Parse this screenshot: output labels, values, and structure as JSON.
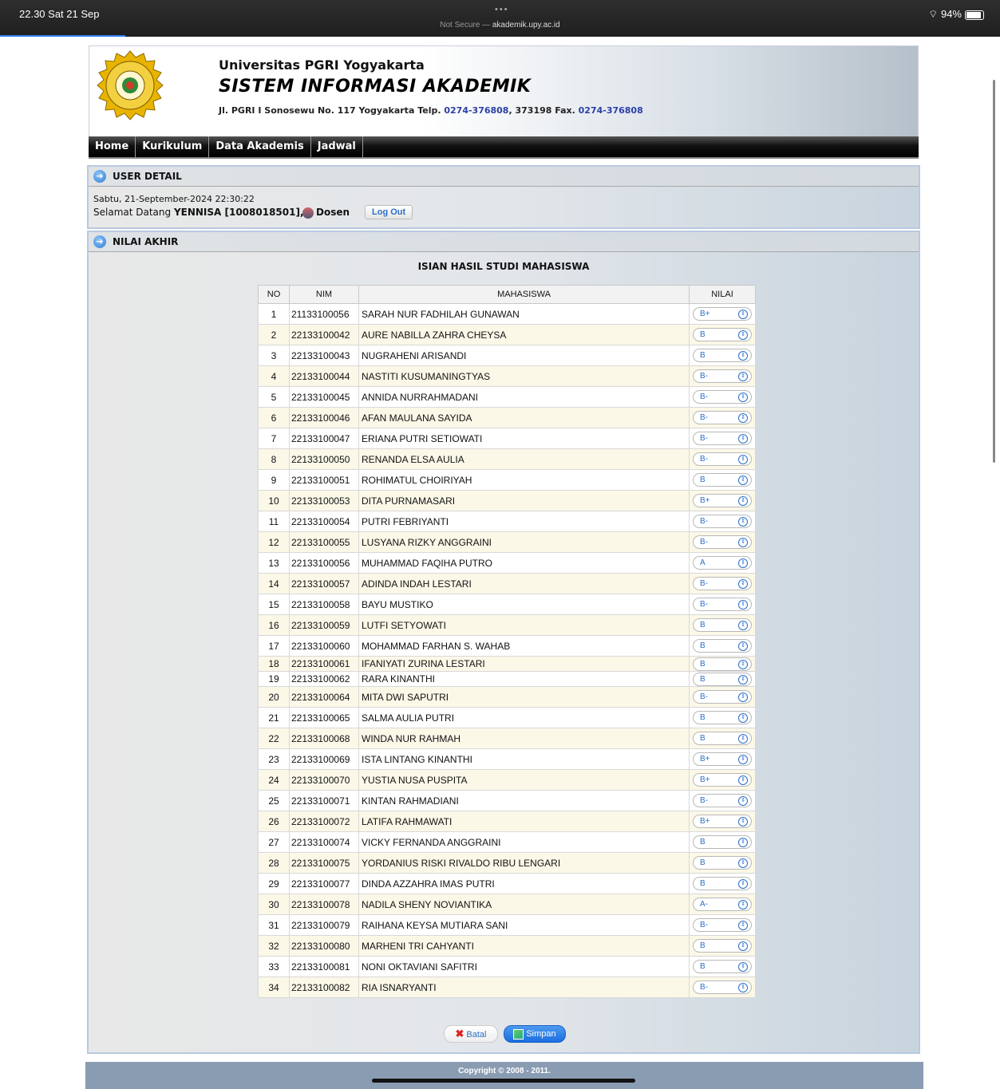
{
  "status": {
    "time": "22.30  Sat 21 Sep",
    "url_prefix": "Not Secure — ",
    "url": "akademik.upy.ac.id",
    "battery": "94%"
  },
  "header": {
    "university": "Universitas PGRI Yogyakarta",
    "system": "SISTEM INFORMASI AKADEMIK",
    "address_1": "Jl. PGRI I Sonosewu No. 117 Yogyakarta Telp. ",
    "phone_1": "0274-376808",
    "address_2": ", 373198 Fax. ",
    "fax": "0274-376808"
  },
  "nav": {
    "items": [
      "Home",
      "Kurikulum",
      "Data Akademis",
      "Jadwal"
    ]
  },
  "user_detail": {
    "title": "USER DETAIL",
    "datetime": "Sabtu, 21-September-2024 22:30:22",
    "welcome_prefix": "Selamat Datang ",
    "user": "YENNISA [1008018501],",
    "role": "Dosen",
    "logout_label": "Log Out"
  },
  "nilai": {
    "title": "NILAI AKHIR",
    "table_title": "ISIAN HASIL STUDI MAHASISWA",
    "columns": [
      "NO",
      "NIM",
      "MAHASISWA",
      "NILAI"
    ],
    "rows": [
      {
        "no": "1",
        "nim": "21133100056",
        "name": "SARAH NUR FADHILAH GUNAWAN",
        "grade": "B+"
      },
      {
        "no": "2",
        "nim": "22133100042",
        "name": "AURE NABILLA ZAHRA CHEYSA",
        "grade": "B"
      },
      {
        "no": "3",
        "nim": "22133100043",
        "name": "NUGRAHENI ARISANDI",
        "grade": "B"
      },
      {
        "no": "4",
        "nim": "22133100044",
        "name": "NASTITI KUSUMANINGTYAS",
        "grade": "B-"
      },
      {
        "no": "5",
        "nim": "22133100045",
        "name": "ANNIDA NURRAHMADANI",
        "grade": "B-"
      },
      {
        "no": "6",
        "nim": "22133100046",
        "name": "AFAN MAULANA SAYIDA",
        "grade": "B-"
      },
      {
        "no": "7",
        "nim": "22133100047",
        "name": "ERIANA PUTRI SETIOWATI",
        "grade": "B-"
      },
      {
        "no": "8",
        "nim": "22133100050",
        "name": "RENANDA ELSA AULIA",
        "grade": "B-"
      },
      {
        "no": "9",
        "nim": "22133100051",
        "name": "ROHIMATUL CHOIRIYAH",
        "grade": "B"
      },
      {
        "no": "10",
        "nim": "22133100053",
        "name": "DITA PURNAMASARI",
        "grade": "B+"
      },
      {
        "no": "11",
        "nim": "22133100054",
        "name": "PUTRI FEBRIYANTI",
        "grade": "B-"
      },
      {
        "no": "12",
        "nim": "22133100055",
        "name": "LUSYANA RIZKY ANGGRAINI",
        "grade": "B-"
      },
      {
        "no": "13",
        "nim": "22133100056",
        "name": "MUHAMMAD FAQIHA PUTRO",
        "grade": "A"
      },
      {
        "no": "14",
        "nim": "22133100057",
        "name": "ADINDA INDAH LESTARI",
        "grade": "B-"
      },
      {
        "no": "15",
        "nim": "22133100058",
        "name": "BAYU MUSTIKO",
        "grade": "B-"
      },
      {
        "no": "16",
        "nim": "22133100059",
        "name": "LUTFI SETYOWATI",
        "grade": "B"
      },
      {
        "no": "17",
        "nim": "22133100060",
        "name": "MOHAMMAD FARHAN S. WAHAB",
        "grade": "B"
      },
      {
        "no": "18",
        "nim": "22133100061",
        "name": "IFANIYATI ZURINA LESTARI",
        "grade": "B"
      },
      {
        "no": "19",
        "nim": "22133100062",
        "name": "RARA KINANTHI",
        "grade": "B"
      },
      {
        "no": "20",
        "nim": "22133100064",
        "name": "MITA DWI SAPUTRI",
        "grade": "B-"
      },
      {
        "no": "21",
        "nim": "22133100065",
        "name": "SALMA AULIA PUTRI",
        "grade": "B"
      },
      {
        "no": "22",
        "nim": "22133100068",
        "name": "WINDA NUR RAHMAH",
        "grade": "B"
      },
      {
        "no": "23",
        "nim": "22133100069",
        "name": "ISTA LINTANG KINANTHI",
        "grade": "B+"
      },
      {
        "no": "24",
        "nim": "22133100070",
        "name": "YUSTIA NUSA PUSPITA",
        "grade": "B+"
      },
      {
        "no": "25",
        "nim": "22133100071",
        "name": "KINTAN RAHMADIANI",
        "grade": "B-"
      },
      {
        "no": "26",
        "nim": "22133100072",
        "name": "LATIFA RAHMAWATI",
        "grade": "B+"
      },
      {
        "no": "27",
        "nim": "22133100074",
        "name": "VICKY FERNANDA ANGGRAINI",
        "grade": "B"
      },
      {
        "no": "28",
        "nim": "22133100075",
        "name": "YORDANIUS RISKI RIVALDO RIBU LENGARI",
        "grade": "B"
      },
      {
        "no": "29",
        "nim": "22133100077",
        "name": "DINDA AZZAHRA IMAS PUTRI",
        "grade": "B"
      },
      {
        "no": "30",
        "nim": "22133100078",
        "name": "NADILA SHENY NOVIANTIKA",
        "grade": "A-"
      },
      {
        "no": "31",
        "nim": "22133100079",
        "name": "RAIHANA KEYSA MUTIARA SANI",
        "grade": "B-"
      },
      {
        "no": "32",
        "nim": "22133100080",
        "name": "MARHENI TRI CAHYANTI",
        "grade": "B"
      },
      {
        "no": "33",
        "nim": "22133100081",
        "name": "NONI OKTAVIANI SAFITRI",
        "grade": "B"
      },
      {
        "no": "34",
        "nim": "22133100082",
        "name": "RIA ISNARYANTI",
        "grade": "B-"
      }
    ],
    "cancel_label": "Batal",
    "save_label": "Simpan"
  },
  "footer": {
    "copyright": "Copyright © 2008 - 2011."
  },
  "colors": {
    "nav_bg": "#000000",
    "link": "#2b3fa8",
    "row_alt": "#fbf8e8",
    "save_button": "#1a6ee0"
  }
}
